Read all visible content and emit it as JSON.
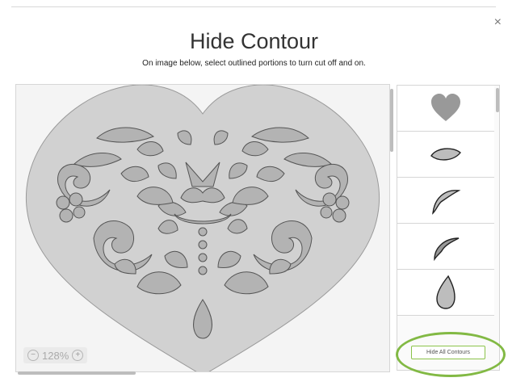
{
  "dialog": {
    "title": "Hide Contour",
    "subtitle": "On image below, select outlined portions to turn cut off and on.",
    "close_icon": "×"
  },
  "canvas": {
    "zoom_level": "128%",
    "zoom_out_icon": "−",
    "zoom_in_icon": "+"
  },
  "contours_panel": {
    "items": [
      {
        "icon": "heart-shape-icon"
      },
      {
        "icon": "leaf-small-icon"
      },
      {
        "icon": "leaf-curved-icon"
      },
      {
        "icon": "leaf-hook-icon"
      },
      {
        "icon": "teardrop-icon"
      }
    ],
    "hide_all_label": "Hide All Contours"
  },
  "colors": {
    "highlight_ring": "#82b944",
    "shape_fill": "#d1d1d1",
    "contour_fill": "#b3b3b3"
  }
}
